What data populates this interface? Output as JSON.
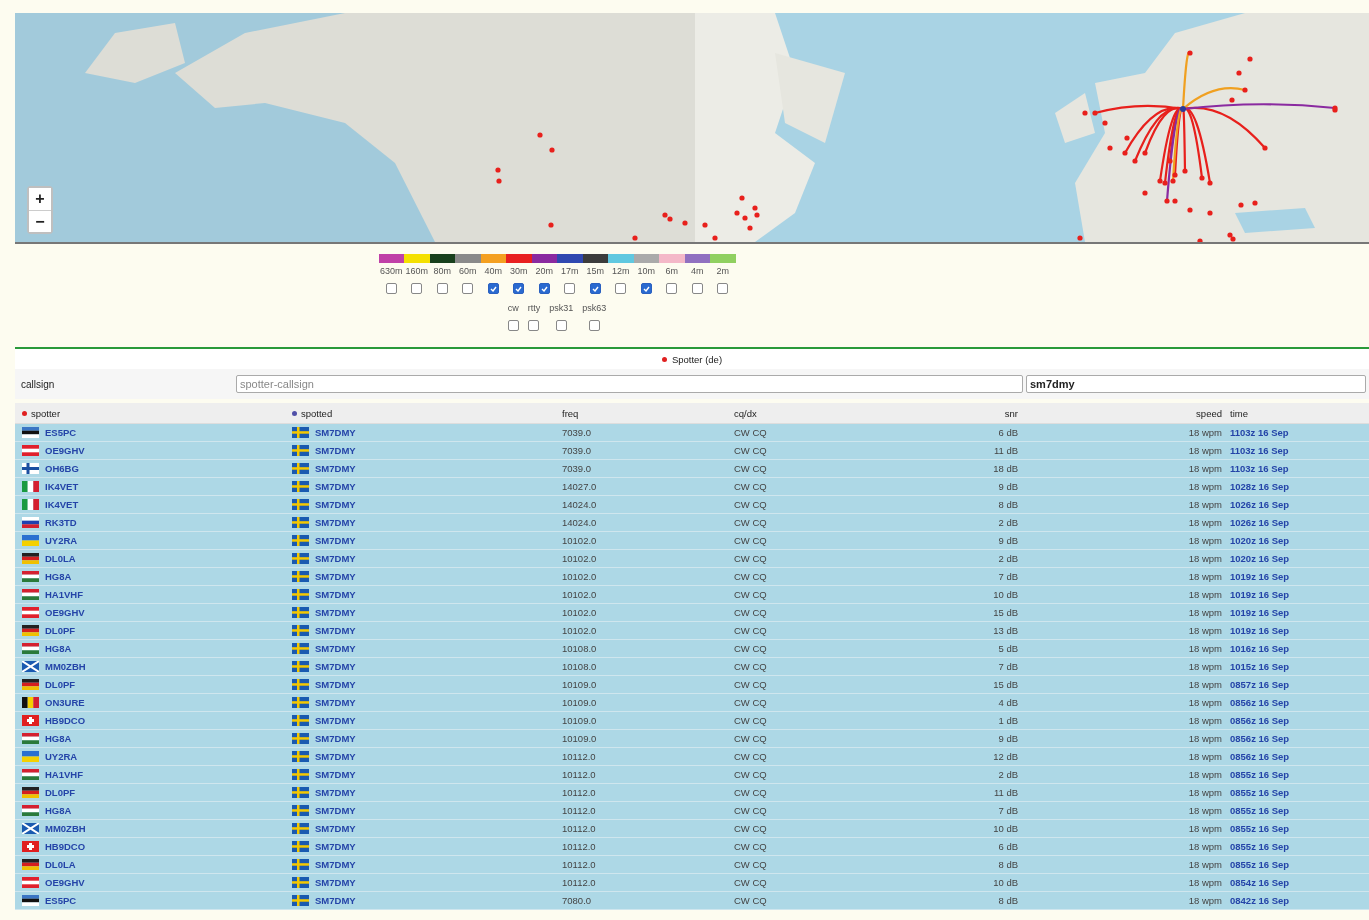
{
  "map": {
    "zoom_in": "+",
    "zoom_out": "−"
  },
  "bands": [
    {
      "label": "630m",
      "color": "#c040a8",
      "checked": false
    },
    {
      "label": "160m",
      "color": "#f4e000",
      "checked": false
    },
    {
      "label": "80m",
      "color": "#18401c",
      "checked": false
    },
    {
      "label": "60m",
      "color": "#8a8a8a",
      "checked": false
    },
    {
      "label": "40m",
      "color": "#f4a020",
      "checked": true
    },
    {
      "label": "30m",
      "color": "#e82020",
      "checked": true
    },
    {
      "label": "20m",
      "color": "#8a2aa0",
      "checked": true
    },
    {
      "label": "17m",
      "color": "#3048b0",
      "checked": false
    },
    {
      "label": "15m",
      "color": "#3c3c3c",
      "checked": true
    },
    {
      "label": "12m",
      "color": "#60c8e0",
      "checked": false
    },
    {
      "label": "10m",
      "color": "#aaaaaa",
      "checked": true
    },
    {
      "label": "6m",
      "color": "#f4b8c8",
      "checked": false
    },
    {
      "label": "4m",
      "color": "#9070c0",
      "checked": false
    },
    {
      "label": "2m",
      "color": "#90d060",
      "checked": false
    }
  ],
  "modes": [
    {
      "label": "cw",
      "checked": false
    },
    {
      "label": "rtty",
      "checked": false
    },
    {
      "label": "psk31",
      "checked": false
    },
    {
      "label": "psk63",
      "checked": false
    }
  ],
  "direction": {
    "label": "Spotter (de)",
    "color": "#e02020"
  },
  "callsign": {
    "label": "callsign",
    "placeholder": "spotter-callsign",
    "value": "sm7dmy"
  },
  "table": {
    "columns": [
      {
        "label": "spotter",
        "color": "#e02020"
      },
      {
        "label": "spotted",
        "color": "#5050a8"
      },
      {
        "label": "freq"
      },
      {
        "label": "cq/dx"
      },
      {
        "label": "snr"
      },
      {
        "label": "speed"
      },
      {
        "label": "time"
      }
    ],
    "rows": [
      {
        "spotter": {
          "text": "ES5PC",
          "kind": "ee"
        },
        "spotted": {
          "text": "SM7DMY",
          "kind": "se"
        },
        "freq": "7039.0",
        "mode": "CW CQ",
        "snr": "6 dB",
        "speed": "18 wpm",
        "time": "1103z 16 Sep"
      },
      {
        "spotter": {
          "text": "OE9GHV",
          "kind": "at"
        },
        "spotted": {
          "text": "SM7DMY",
          "kind": "se"
        },
        "freq": "7039.0",
        "mode": "CW CQ",
        "snr": "11 dB",
        "speed": "18 wpm",
        "time": "1103z 16 Sep"
      },
      {
        "spotter": {
          "text": "OH6BG",
          "kind": "fi"
        },
        "spotted": {
          "text": "SM7DMY",
          "kind": "se"
        },
        "freq": "7039.0",
        "mode": "CW CQ",
        "snr": "18 dB",
        "speed": "18 wpm",
        "time": "1103z 16 Sep"
      },
      {
        "spotter": {
          "text": "IK4VET",
          "kind": "it"
        },
        "spotted": {
          "text": "SM7DMY",
          "kind": "se"
        },
        "freq": "14027.0",
        "mode": "CW CQ",
        "snr": "9 dB",
        "speed": "18 wpm",
        "time": "1028z 16 Sep"
      },
      {
        "spotter": {
          "text": "IK4VET",
          "kind": "it"
        },
        "spotted": {
          "text": "SM7DMY",
          "kind": "se"
        },
        "freq": "14024.0",
        "mode": "CW CQ",
        "snr": "8 dB",
        "speed": "18 wpm",
        "time": "1026z 16 Sep"
      },
      {
        "spotter": {
          "text": "RK3TD",
          "kind": "ru"
        },
        "spotted": {
          "text": "SM7DMY",
          "kind": "se"
        },
        "freq": "14024.0",
        "mode": "CW CQ",
        "snr": "2 dB",
        "speed": "18 wpm",
        "time": "1026z 16 Sep"
      },
      {
        "spotter": {
          "text": "UY2RA",
          "kind": "ua"
        },
        "spotted": {
          "text": "SM7DMY",
          "kind": "se"
        },
        "freq": "10102.0",
        "mode": "CW CQ",
        "snr": "9 dB",
        "speed": "18 wpm",
        "time": "1020z 16 Sep"
      },
      {
        "spotter": {
          "text": "DL0LA",
          "kind": "de"
        },
        "spotted": {
          "text": "SM7DMY",
          "kind": "se"
        },
        "freq": "10102.0",
        "mode": "CW CQ",
        "snr": "2 dB",
        "speed": "18 wpm",
        "time": "1020z 16 Sep"
      },
      {
        "spotter": {
          "text": "HG8A",
          "kind": "hu"
        },
        "spotted": {
          "text": "SM7DMY",
          "kind": "se"
        },
        "freq": "10102.0",
        "mode": "CW CQ",
        "snr": "7 dB",
        "speed": "18 wpm",
        "time": "1019z 16 Sep"
      },
      {
        "spotter": {
          "text": "HA1VHF",
          "kind": "hu"
        },
        "spotted": {
          "text": "SM7DMY",
          "kind": "se"
        },
        "freq": "10102.0",
        "mode": "CW CQ",
        "snr": "10 dB",
        "speed": "18 wpm",
        "time": "1019z 16 Sep"
      },
      {
        "spotter": {
          "text": "OE9GHV",
          "kind": "at"
        },
        "spotted": {
          "text": "SM7DMY",
          "kind": "se"
        },
        "freq": "10102.0",
        "mode": "CW CQ",
        "snr": "15 dB",
        "speed": "18 wpm",
        "time": "1019z 16 Sep"
      },
      {
        "spotter": {
          "text": "DL0PF",
          "kind": "de"
        },
        "spotted": {
          "text": "SM7DMY",
          "kind": "se"
        },
        "freq": "10102.0",
        "mode": "CW CQ",
        "snr": "13 dB",
        "speed": "18 wpm",
        "time": "1019z 16 Sep"
      },
      {
        "spotter": {
          "text": "HG8A",
          "kind": "hu"
        },
        "spotted": {
          "text": "SM7DMY",
          "kind": "se"
        },
        "freq": "10108.0",
        "mode": "CW CQ",
        "snr": "5 dB",
        "speed": "18 wpm",
        "time": "1016z 16 Sep"
      },
      {
        "spotter": {
          "text": "MM0ZBH",
          "kind": "sct"
        },
        "spotted": {
          "text": "SM7DMY",
          "kind": "se"
        },
        "freq": "10108.0",
        "mode": "CW CQ",
        "snr": "7 dB",
        "speed": "18 wpm",
        "time": "1015z 16 Sep"
      },
      {
        "spotter": {
          "text": "DL0PF",
          "kind": "de"
        },
        "spotted": {
          "text": "SM7DMY",
          "kind": "se"
        },
        "freq": "10109.0",
        "mode": "CW CQ",
        "snr": "15 dB",
        "speed": "18 wpm",
        "time": "0857z 16 Sep"
      },
      {
        "spotter": {
          "text": "ON3URE",
          "kind": "be"
        },
        "spotted": {
          "text": "SM7DMY",
          "kind": "se"
        },
        "freq": "10109.0",
        "mode": "CW CQ",
        "snr": "4 dB",
        "speed": "18 wpm",
        "time": "0856z 16 Sep"
      },
      {
        "spotter": {
          "text": "HB9DCO",
          "kind": "ch"
        },
        "spotted": {
          "text": "SM7DMY",
          "kind": "se"
        },
        "freq": "10109.0",
        "mode": "CW CQ",
        "snr": "1 dB",
        "speed": "18 wpm",
        "time": "0856z 16 Sep"
      },
      {
        "spotter": {
          "text": "HG8A",
          "kind": "hu"
        },
        "spotted": {
          "text": "SM7DMY",
          "kind": "se"
        },
        "freq": "10109.0",
        "mode": "CW CQ",
        "snr": "9 dB",
        "speed": "18 wpm",
        "time": "0856z 16 Sep"
      },
      {
        "spotter": {
          "text": "UY2RA",
          "kind": "ua"
        },
        "spotted": {
          "text": "SM7DMY",
          "kind": "se"
        },
        "freq": "10112.0",
        "mode": "CW CQ",
        "snr": "12 dB",
        "speed": "18 wpm",
        "time": "0856z 16 Sep"
      },
      {
        "spotter": {
          "text": "HA1VHF",
          "kind": "hu"
        },
        "spotted": {
          "text": "SM7DMY",
          "kind": "se"
        },
        "freq": "10112.0",
        "mode": "CW CQ",
        "snr": "2 dB",
        "speed": "18 wpm",
        "time": "0855z 16 Sep"
      },
      {
        "spotter": {
          "text": "DL0PF",
          "kind": "de"
        },
        "spotted": {
          "text": "SM7DMY",
          "kind": "se"
        },
        "freq": "10112.0",
        "mode": "CW CQ",
        "snr": "11 dB",
        "speed": "18 wpm",
        "time": "0855z 16 Sep"
      },
      {
        "spotter": {
          "text": "HG8A",
          "kind": "hu"
        },
        "spotted": {
          "text": "SM7DMY",
          "kind": "se"
        },
        "freq": "10112.0",
        "mode": "CW CQ",
        "snr": "7 dB",
        "speed": "18 wpm",
        "time": "0855z 16 Sep"
      },
      {
        "spotter": {
          "text": "MM0ZBH",
          "kind": "sct"
        },
        "spotted": {
          "text": "SM7DMY",
          "kind": "se"
        },
        "freq": "10112.0",
        "mode": "CW CQ",
        "snr": "10 dB",
        "speed": "18 wpm",
        "time": "0855z 16 Sep"
      },
      {
        "spotter": {
          "text": "HB9DCO",
          "kind": "ch"
        },
        "spotted": {
          "text": "SM7DMY",
          "kind": "se"
        },
        "freq": "10112.0",
        "mode": "CW CQ",
        "snr": "6 dB",
        "speed": "18 wpm",
        "time": "0855z 16 Sep"
      },
      {
        "spotter": {
          "text": "DL0LA",
          "kind": "de"
        },
        "spotted": {
          "text": "SM7DMY",
          "kind": "se"
        },
        "freq": "10112.0",
        "mode": "CW CQ",
        "snr": "8 dB",
        "speed": "18 wpm",
        "time": "0855z 16 Sep"
      },
      {
        "spotter": {
          "text": "OE9GHV",
          "kind": "at"
        },
        "spotted": {
          "text": "SM7DMY",
          "kind": "se"
        },
        "freq": "10112.0",
        "mode": "CW CQ",
        "snr": "10 dB",
        "speed": "18 wpm",
        "time": "0854z 16 Sep"
      },
      {
        "spotter": {
          "text": "ES5PC",
          "kind": "ee"
        },
        "spotted": {
          "text": "SM7DMY",
          "kind": "se"
        },
        "freq": "7080.0",
        "mode": "CW CQ",
        "snr": "8 dB",
        "speed": "18 wpm",
        "time": "0842z 16 Sep"
      }
    ]
  }
}
